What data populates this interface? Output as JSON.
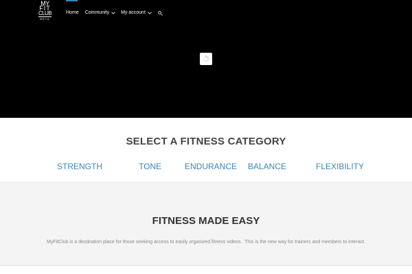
{
  "header": {
    "logo": {
      "line1": "MY",
      "line2": "FIT",
      "line3": "CLUB",
      "line4": "BETA"
    },
    "nav": [
      {
        "label": "Home",
        "active": true,
        "has_dropdown": false
      },
      {
        "label": "Community",
        "active": false,
        "has_dropdown": true
      },
      {
        "label": "My account",
        "active": false,
        "has_dropdown": true
      }
    ],
    "search_icon": "search-icon"
  },
  "hero": {
    "loader_icon": "spinner-icon"
  },
  "categories": {
    "title": "SELECT A FITNESS CATEGORY",
    "items": [
      "STRENGTH",
      "TONE",
      "ENDURANCE",
      "BALANCE",
      "FLEXIBILITY"
    ]
  },
  "about": {
    "title": "FITNESS MADE EASY",
    "text": "MyFitClub is a destination place for those seeking access to easily organized fitness videos.  This is the new way for trainers and members to interact."
  },
  "colors": {
    "hero_bg": "#000000",
    "accent": "#3a87b7",
    "section_bg": "#f4f4f4"
  }
}
